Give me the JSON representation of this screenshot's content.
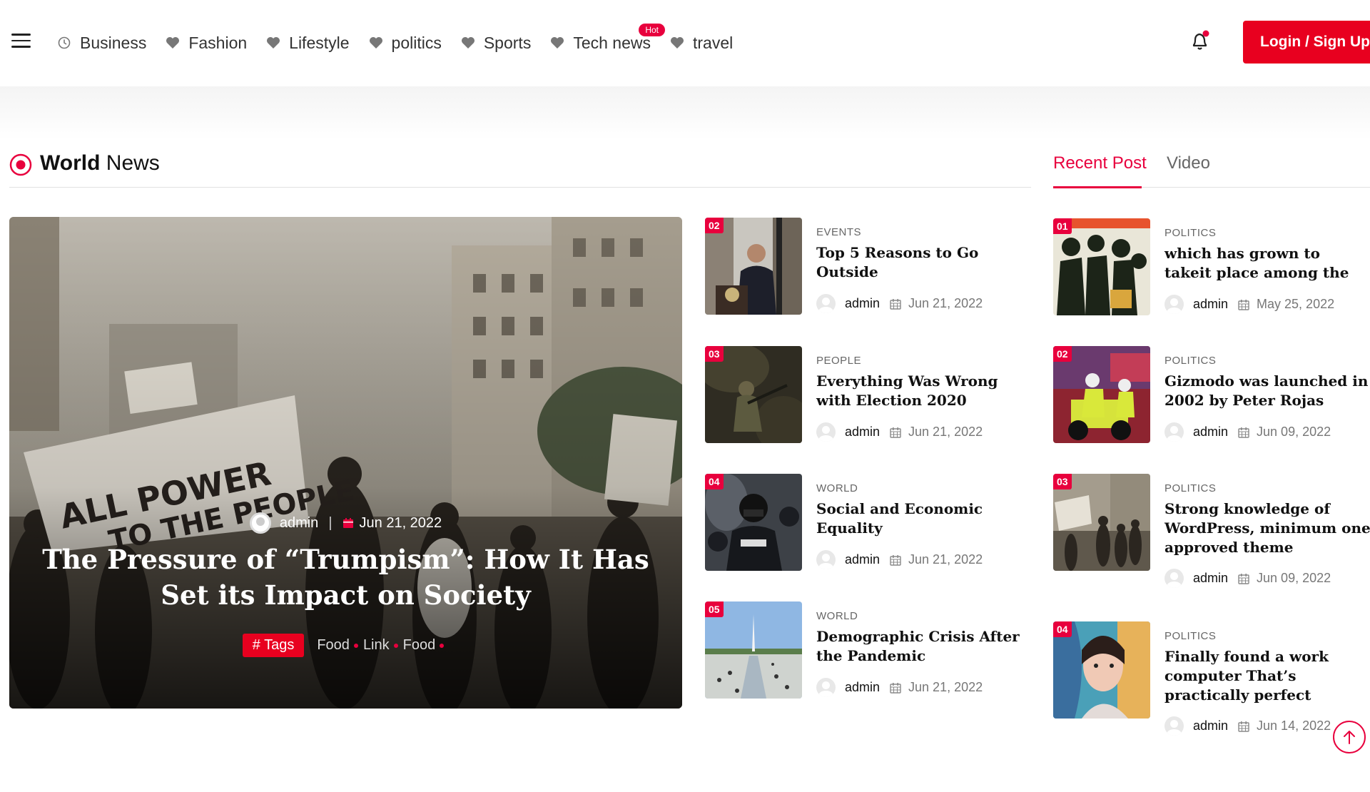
{
  "header": {
    "nav": [
      {
        "label": "Business",
        "icon": "clock-icon"
      },
      {
        "label": "Fashion",
        "icon": "heart-icon"
      },
      {
        "label": "Lifestyle",
        "icon": "heart-icon"
      },
      {
        "label": "politics",
        "icon": "heart-icon"
      },
      {
        "label": "Sports",
        "icon": "heart-icon"
      },
      {
        "label": "Tech news",
        "icon": "heart-icon",
        "badge": "Hot"
      },
      {
        "label": "travel",
        "icon": "heart-icon"
      }
    ],
    "login_label": "Login / Sign Up"
  },
  "section": {
    "title_bold": "World",
    "title_rest": "News"
  },
  "tabs": {
    "recent": "Recent Post",
    "video": "Video"
  },
  "hero": {
    "author": "admin",
    "date": "Jun 21, 2022",
    "title": "The Pressure of “Trumpism”: How It Has Set its Impact on Society",
    "tag_main": "# Tags",
    "tags": [
      "Food",
      "Link",
      "Food"
    ]
  },
  "middle_list": [
    {
      "num": "02",
      "category": "EVENTS",
      "title": "Top 5 Reasons to Go Outside",
      "author": "admin",
      "date": "Jun 21, 2022"
    },
    {
      "num": "03",
      "category": "PEOPLE",
      "title": "Everything Was Wrong with Election 2020",
      "author": "admin",
      "date": "Jun 21, 2022"
    },
    {
      "num": "04",
      "category": "WORLD",
      "title": "Social and Economic Equality",
      "author": "admin",
      "date": "Jun 21, 2022"
    },
    {
      "num": "05",
      "category": "WORLD",
      "title": "Demographic Crisis After the Pandemic",
      "author": "admin",
      "date": "Jun 21, 2022"
    }
  ],
  "recent_list": [
    {
      "num": "01",
      "category": "POLITICS",
      "title": "which has grown to takeit place among the",
      "author": "admin",
      "date": "May 25, 2022"
    },
    {
      "num": "02",
      "category": "POLITICS",
      "title": "Gizmodo was launched in 2002 by Peter Rojas",
      "author": "admin",
      "date": "Jun 09, 2022"
    },
    {
      "num": "03",
      "category": "POLITICS",
      "title": "Strong knowledge of WordPress, minimum one approved theme",
      "author": "admin",
      "date": "Jun 09, 2022"
    },
    {
      "num": "04",
      "category": "POLITICS",
      "title": "Finally found a work computer That’s practically perfect",
      "author": "admin",
      "date": "Jun 14, 2022"
    }
  ],
  "colors": {
    "accent": "#e8003d",
    "button": "#e8001f"
  }
}
